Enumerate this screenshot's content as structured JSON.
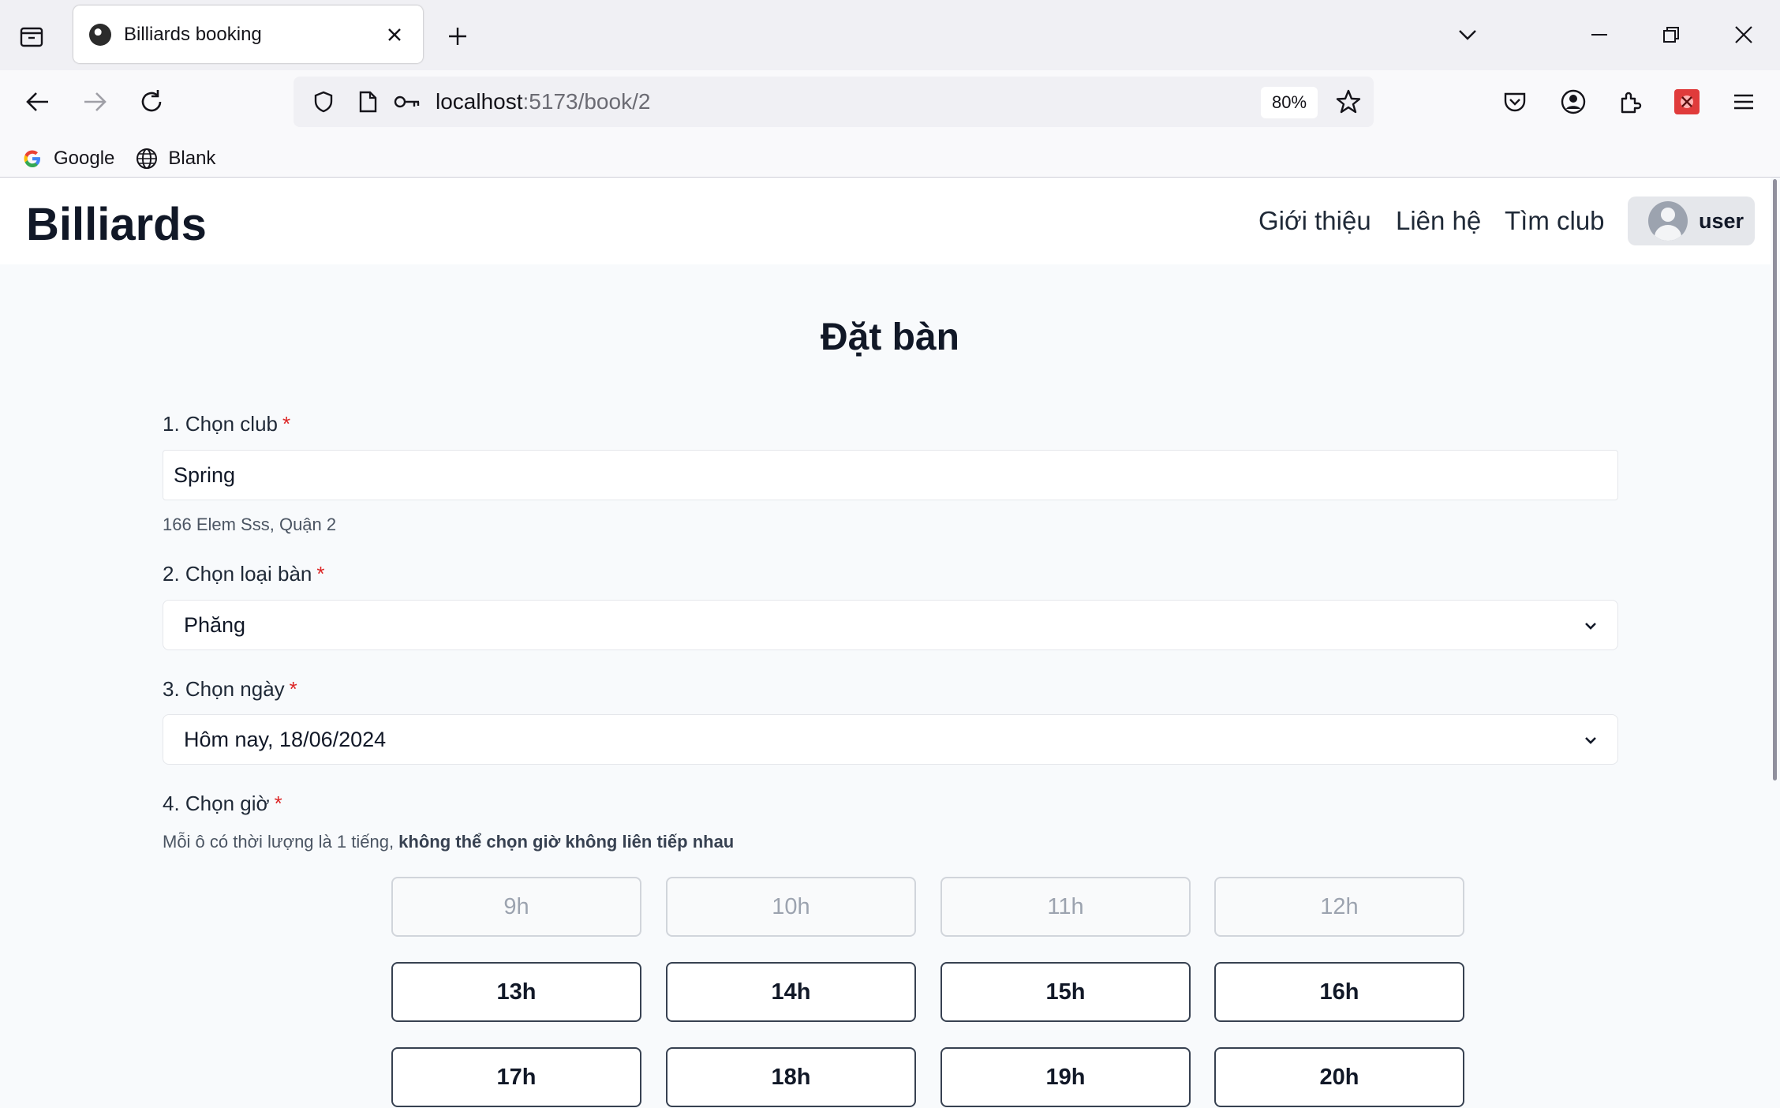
{
  "browser": {
    "tab_title": "Billiards booking",
    "url_host": "localhost",
    "url_path": ":5173/book/2",
    "zoom": "80%",
    "bookmarks": [
      {
        "label": "Google",
        "icon": "google-icon"
      },
      {
        "label": "Blank",
        "icon": "globe-icon"
      }
    ]
  },
  "site": {
    "brand": "Billiards",
    "nav": [
      "Giới thiệu",
      "Liên hệ",
      "Tìm club"
    ],
    "user": "user"
  },
  "form": {
    "title": "Đặt bàn",
    "required_mark": "*",
    "club": {
      "label": "1. Chọn club",
      "value": "Spring",
      "address": "166 Elem Sss, Quận 2"
    },
    "table_type": {
      "label": "2. Chọn loại bàn",
      "value": "Phăng"
    },
    "date": {
      "label": "3. Chọn ngày",
      "value": "Hôm nay, 18/06/2024"
    },
    "time": {
      "label": "4. Chọn giờ",
      "note_plain": "Mỗi ô có thời lượng là 1 tiếng, ",
      "note_bold": "không thể chọn giờ không liên tiếp nhau",
      "slots": [
        {
          "label": "9h",
          "available": false
        },
        {
          "label": "10h",
          "available": false
        },
        {
          "label": "11h",
          "available": false
        },
        {
          "label": "12h",
          "available": false
        },
        {
          "label": "13h",
          "available": true
        },
        {
          "label": "14h",
          "available": true
        },
        {
          "label": "15h",
          "available": true
        },
        {
          "label": "16h",
          "available": true
        },
        {
          "label": "17h",
          "available": true
        },
        {
          "label": "18h",
          "available": true
        },
        {
          "label": "19h",
          "available": true
        },
        {
          "label": "20h",
          "available": true
        }
      ]
    }
  }
}
